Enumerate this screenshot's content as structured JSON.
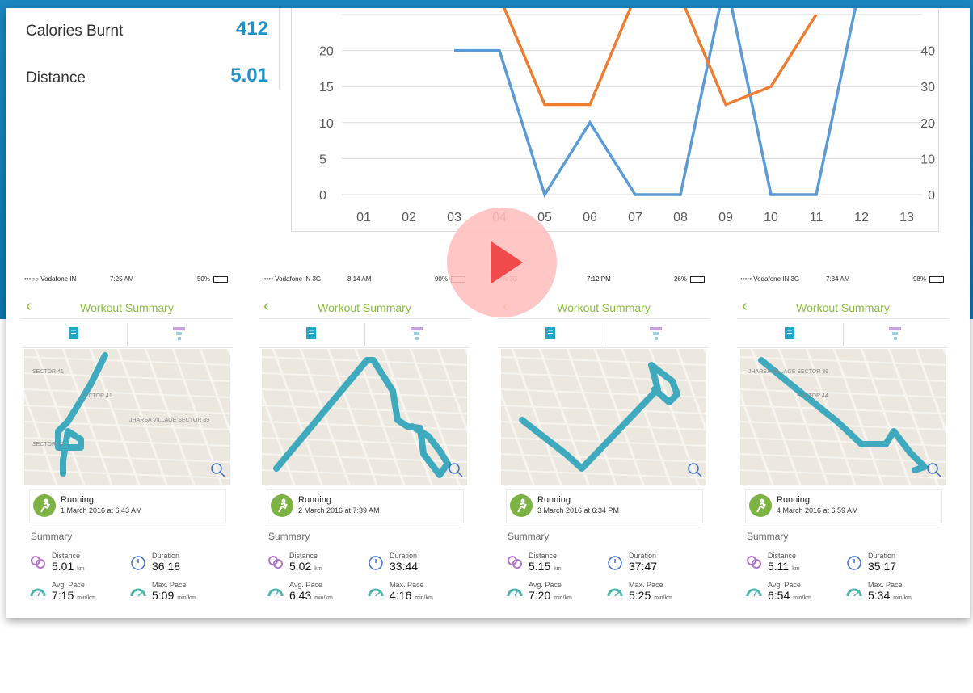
{
  "stats": [
    {
      "label": "Calories Burnt",
      "value": "412"
    },
    {
      "label": "Distance",
      "value": "5.01"
    }
  ],
  "chart_data": {
    "type": "line",
    "categories": [
      "01",
      "02",
      "03",
      "04",
      "05",
      "06",
      "07",
      "08",
      "09",
      "10",
      "11",
      "12",
      "13"
    ],
    "left_ticks": [
      "0",
      "5",
      "10",
      "15",
      "20"
    ],
    "right_ticks": [
      "0",
      "10",
      "20",
      "30",
      "40"
    ],
    "ylim_left": [
      0,
      25
    ],
    "ylim_right": [
      0,
      50
    ],
    "series": [
      {
        "color": "#5b9bd5",
        "axis": "left",
        "values": [
          null,
          null,
          20,
          20,
          0,
          10,
          0,
          0,
          30,
          0,
          0,
          30,
          null
        ]
      },
      {
        "color": "#ed7d31",
        "axis": "right",
        "values": [
          null,
          null,
          null,
          55,
          25,
          25,
          55,
          55,
          25,
          30,
          50,
          null,
          null
        ]
      }
    ]
  },
  "workouts": [
    {
      "carrier": "•••○○ Vodafone IN",
      "time": "7:25 AM",
      "battery": "50%",
      "title": "Workout Summary",
      "activity": "Running",
      "date": "1 March 2016 at 6:43 AM",
      "summary_title": "Summary",
      "distance_label": "Distance",
      "distance": "5.01",
      "distance_unit": "km",
      "duration_label": "Duration",
      "duration": "36:18",
      "avg_label": "Avg. Pace",
      "avg_pace": "7:15",
      "avg_unit": "min/km",
      "max_label": "Max. Pace",
      "max_pace": "5:09",
      "max_unit": "min/km",
      "map_labels": [
        "SECTOR 41",
        "SECTOR 41",
        "JHARSA VILLAGE SECTOR 39",
        "SECTOR 40"
      ]
    },
    {
      "carrier": "••••• Vodafone IN  3G",
      "time": "8:14 AM",
      "battery": "90%",
      "title": "Workout Summary",
      "activity": "Running",
      "date": "2 March 2016 at 7:39 AM",
      "summary_title": "Summary",
      "distance_label": "Distance",
      "distance": "5.02",
      "distance_unit": "km",
      "duration_label": "Duration",
      "duration": "33:44",
      "avg_label": "Avg. Pace",
      "avg_pace": "6:43",
      "avg_unit": "min/km",
      "max_label": "Max. Pace",
      "max_pace": "4:16",
      "max_unit": "min/km",
      "map_labels": []
    },
    {
      "carrier": "IN  3G",
      "time": "7:12 PM",
      "battery": "26%",
      "title": "Workout Summary",
      "activity": "Running",
      "date": "3 March 2016 at 6:34 PM",
      "summary_title": "Summary",
      "distance_label": "Distance",
      "distance": "5.15",
      "distance_unit": "km",
      "duration_label": "Duration",
      "duration": "37:47",
      "avg_label": "Avg. Pace",
      "avg_pace": "7:20",
      "avg_unit": "min/km",
      "max_label": "Max. Pace",
      "max_pace": "5:25",
      "max_unit": "min/km",
      "map_labels": []
    },
    {
      "carrier": "••••• Vodafone IN  3G",
      "time": "7:34 AM",
      "battery": "98%",
      "title": "Workout Summary",
      "activity": "Running",
      "date": "4 March 2016 at 6:59 AM",
      "summary_title": "Summary",
      "distance_label": "Distance",
      "distance": "5.11",
      "distance_unit": "km",
      "duration_label": "Duration",
      "duration": "35:17",
      "avg_label": "Avg. Pace",
      "avg_pace": "6:54",
      "avg_unit": "min/km",
      "max_label": "Max. Pace",
      "max_pace": "5:34",
      "max_unit": "min/km",
      "map_labels": [
        "JHARSA VILLAGE SECTOR 39",
        "SECTOR 44"
      ]
    }
  ],
  "play_button": {
    "icon": "play-icon",
    "color": "#f04a4a"
  }
}
